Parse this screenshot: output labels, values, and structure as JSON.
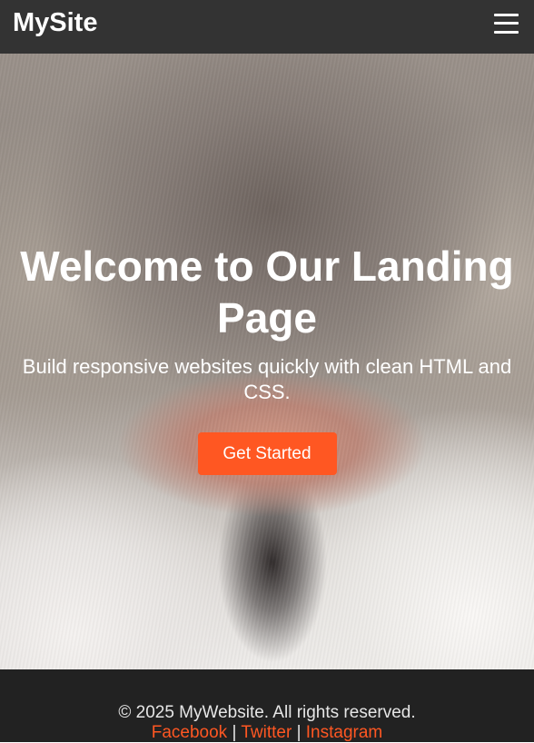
{
  "navbar": {
    "logo": "MySite",
    "menu_icon": "hamburger-menu-icon"
  },
  "hero": {
    "title_lines": [
      "Welcome to Our Landing",
      "Page"
    ],
    "subtitle_lines": [
      "Build responsive websites quickly with clean HTML and",
      "CSS."
    ],
    "cta_label": "Get Started",
    "background_image": "close-up of a cat's nose"
  },
  "footer": {
    "copyright": "© 2025 MyWebsite. All rights reserved.",
    "links": [
      "Facebook",
      "Twitter",
      "Instagram"
    ],
    "separator": "|"
  },
  "colors": {
    "navbar_bg": "#333333",
    "footer_bg": "#222222",
    "accent": "#ff5722",
    "text_light": "#ffffff"
  }
}
